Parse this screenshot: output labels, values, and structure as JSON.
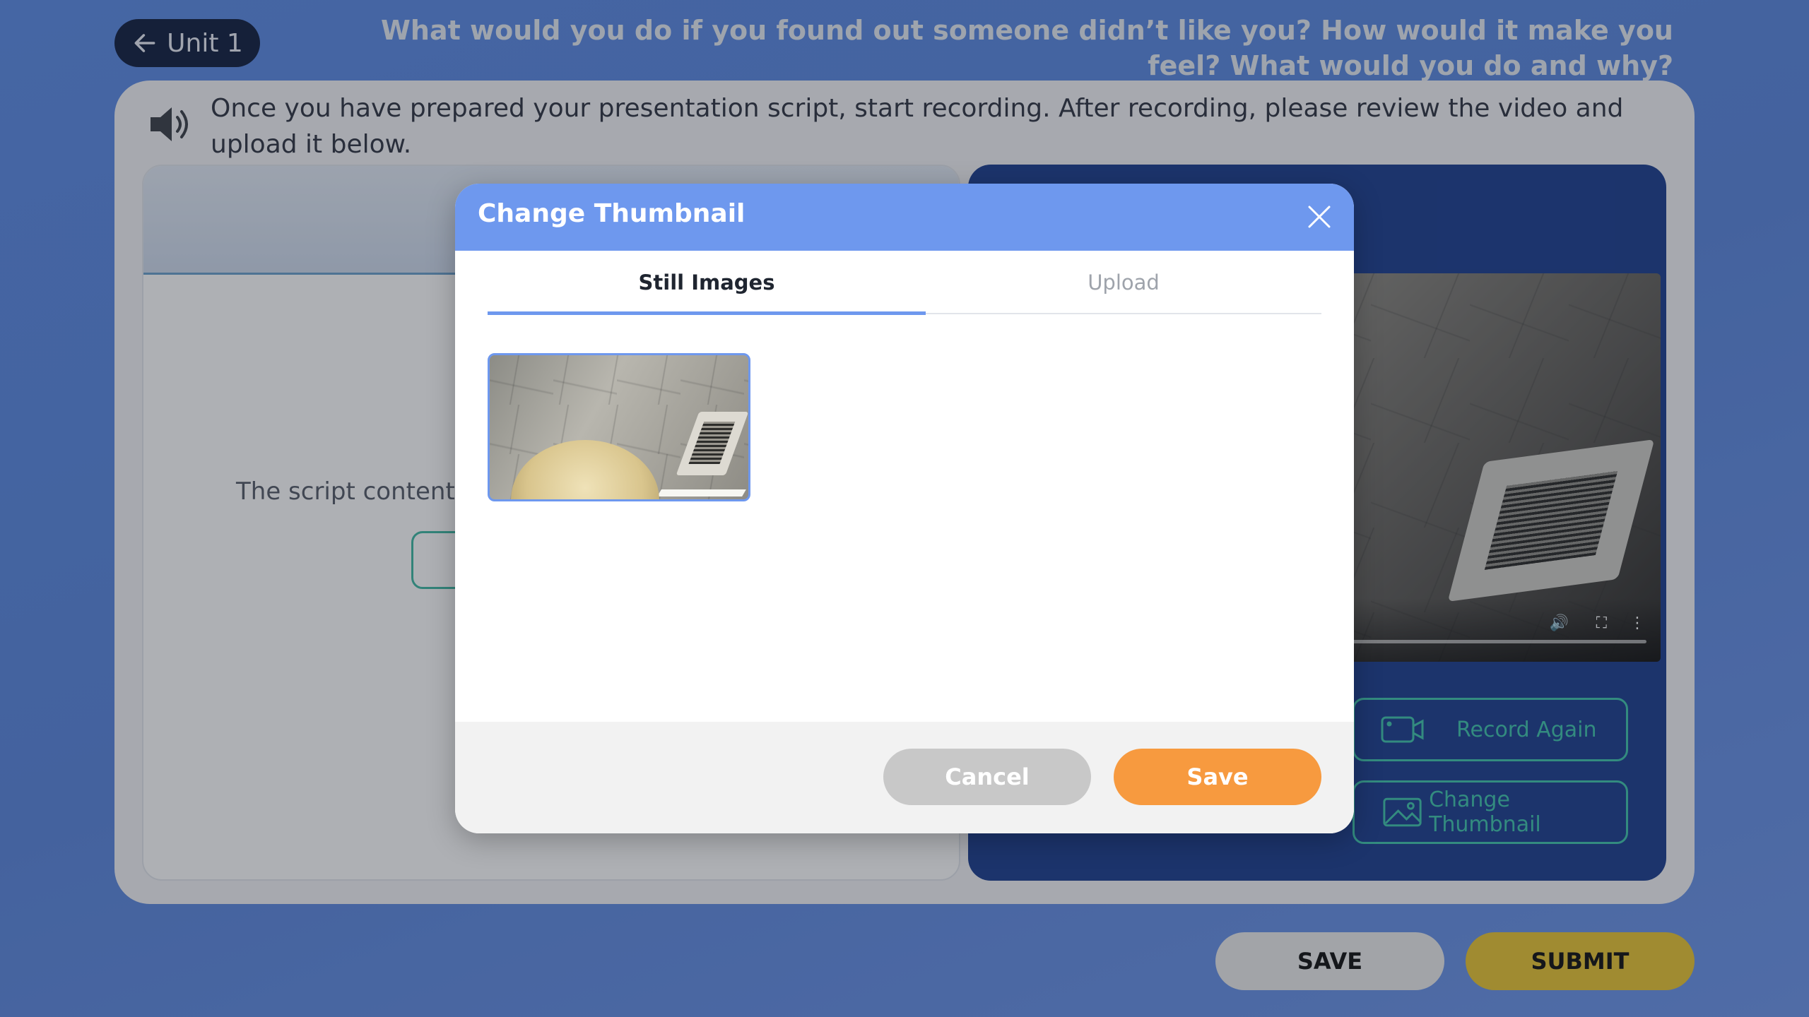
{
  "header": {
    "back_label": "Unit 1",
    "question": "What would you do if you found out someone didn’t like you? How would it make you feel? What would you do and why?"
  },
  "instructions": {
    "text": "Once you have prepared your presentation script, start recording. After recording, please review the video and upload it below."
  },
  "script_panel": {
    "empty_text": "The script content c"
  },
  "video_panel": {
    "record_again_label": "Record Again",
    "change_thumbnail_label": "Change Thumbnail"
  },
  "footer": {
    "save_label": "SAVE",
    "submit_label": "SUBMIT"
  },
  "modal": {
    "title": "Change Thumbnail",
    "tabs": [
      {
        "label": "Still Images",
        "active": true
      },
      {
        "label": "Upload",
        "active": false
      }
    ],
    "cancel_label": "Cancel",
    "save_label": "Save"
  },
  "colors": {
    "background": "#5b8be6",
    "modal_header": "#6e98ee",
    "save_orange": "#f79a3f",
    "cancel_gray": "#c8c8c8",
    "submit_yellow": "#e9c533",
    "teal_accent": "#3fc6ad",
    "dark_navy": "#101e3f"
  },
  "icons": [
    "arrow-left-icon",
    "speaker-icon",
    "close-icon",
    "video-camera-icon",
    "image-icon",
    "volume-icon",
    "fullscreen-icon",
    "more-vertical-icon"
  ]
}
